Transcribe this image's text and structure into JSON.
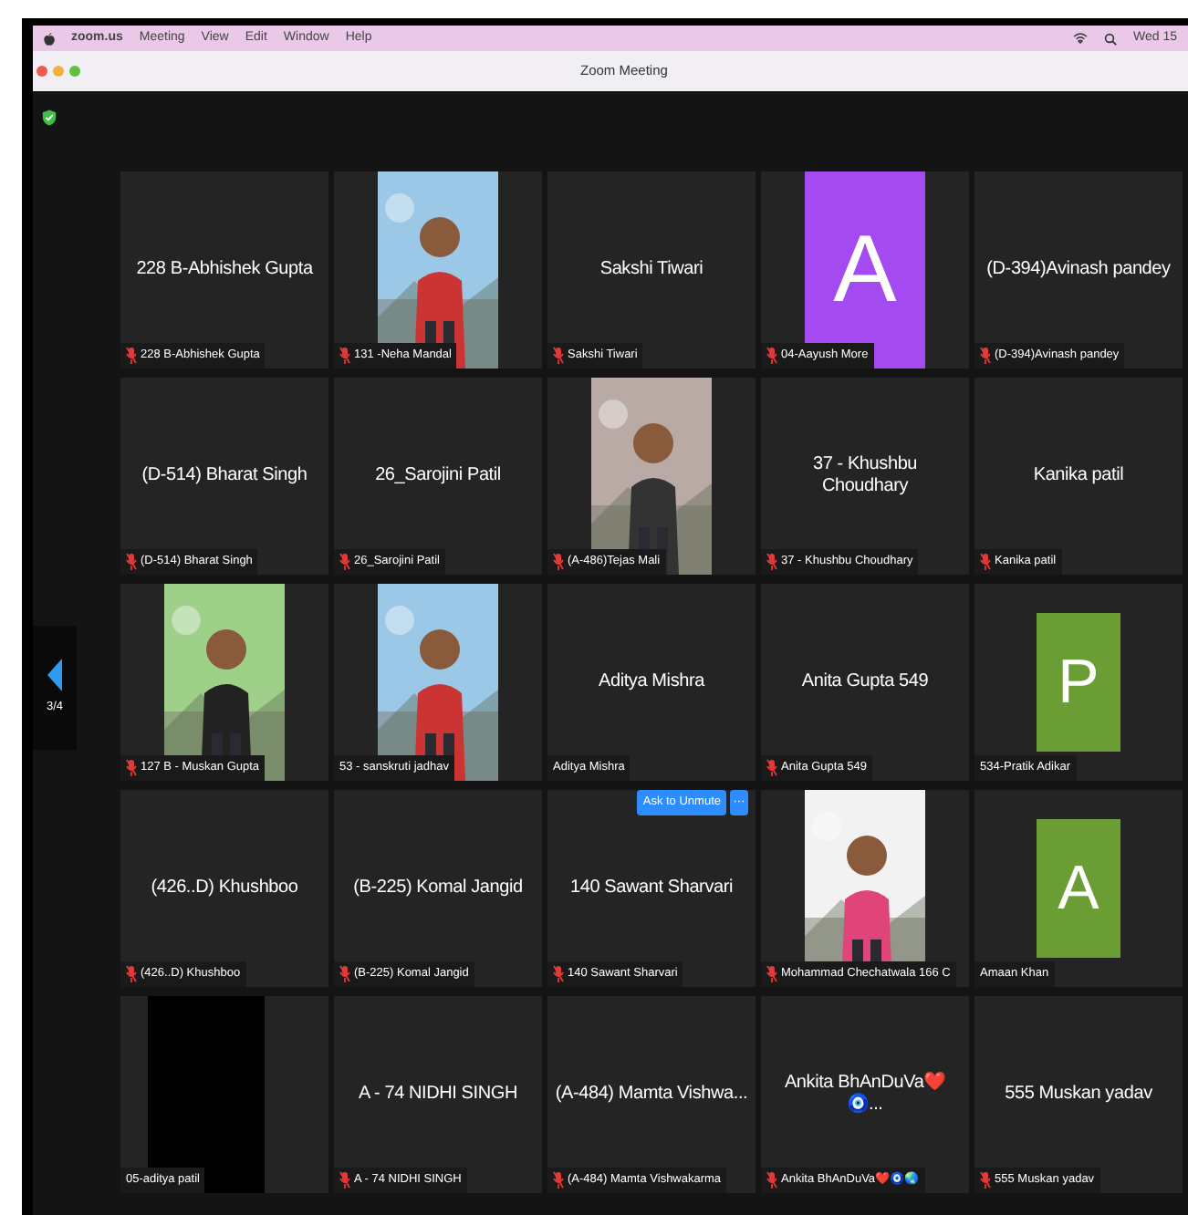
{
  "menu_bar": {
    "app": "zoom.us",
    "items": [
      "Meeting",
      "View",
      "Edit",
      "Window",
      "Help"
    ],
    "clock": "Wed 15"
  },
  "window": {
    "title": "Zoom Meeting"
  },
  "pager": {
    "label": "3/4"
  },
  "tiles": [
    {
      "kind": "name",
      "name": "228 B-Abhishek Gupta",
      "label": "228 B-Abhishek Gupta",
      "muted": true
    },
    {
      "kind": "picture",
      "label": "131 -Neha Mandal",
      "muted": true
    },
    {
      "kind": "name",
      "name": "Sakshi Tiwari",
      "label": "Sakshi Tiwari",
      "muted": true
    },
    {
      "kind": "avatar",
      "letter": "A",
      "color": "#a34bf0",
      "large": true,
      "label": "04-Aayush More",
      "muted": true
    },
    {
      "kind": "name",
      "name": "(D-394)Avinash pandey",
      "label": "(D-394)Avinash pandey",
      "muted": true
    },
    {
      "kind": "name",
      "name": "(D-514) Bharat Singh",
      "label": "(D-514) Bharat Singh",
      "muted": true
    },
    {
      "kind": "name",
      "name": "26_Sarojini Patil",
      "label": "26_Sarojini Patil",
      "muted": true
    },
    {
      "kind": "picture",
      "label": "(A-486)Tejas Mali",
      "muted": true
    },
    {
      "kind": "name",
      "name": "37 - Khushbu Choudhary",
      "label": "37 - Khushbu Choudhary",
      "muted": true
    },
    {
      "kind": "name",
      "name": "Kanika patil",
      "label": "Kanika patil",
      "muted": true
    },
    {
      "kind": "picture",
      "label": "127 B - Muskan Gupta",
      "muted": true
    },
    {
      "kind": "picture",
      "label": "53 - sanskruti jadhav",
      "muted": false
    },
    {
      "kind": "name",
      "name": "Aditya Mishra",
      "label": "Aditya Mishra",
      "muted": false
    },
    {
      "kind": "name",
      "name": "Anita Gupta 549",
      "label": "Anita Gupta 549",
      "muted": true
    },
    {
      "kind": "avatar",
      "letter": "P",
      "color": "#6a9e35",
      "large": false,
      "label": "534-Pratik Adikar",
      "muted": false
    },
    {
      "kind": "name",
      "name": "(426..D) Khushboo",
      "label": "(426..D) Khushboo",
      "muted": true
    },
    {
      "kind": "name",
      "name": "(B-225) Komal Jangid",
      "label": "(B-225) Komal Jangid",
      "muted": true
    },
    {
      "kind": "name",
      "name": "140 Sawant Sharvari",
      "label": "140 Sawant Sharvari",
      "muted": true,
      "ask_button": "Ask to Unmute",
      "more_button": "···"
    },
    {
      "kind": "picture",
      "label": "Mohammad Chechatwala 166 C",
      "muted": true
    },
    {
      "kind": "avatar",
      "letter": "A",
      "color": "#6a9e35",
      "large": false,
      "label": "Amaan Khan",
      "muted": false
    },
    {
      "kind": "blank",
      "label": "05-aditya patil",
      "muted": false
    },
    {
      "kind": "name",
      "name": "A - 74  NIDHI SINGH",
      "label": "A - 74  NIDHI SINGH",
      "muted": true
    },
    {
      "kind": "name",
      "name": "(A-484) Mamta Vishwa...",
      "label": "(A-484) Mamta Vishwakarma",
      "muted": true
    },
    {
      "kind": "name",
      "name": "Ankita BhAnDuVa❤️ 🧿...",
      "label": "Ankita BhAnDuVa❤️🧿🌏",
      "muted": true
    },
    {
      "kind": "name",
      "name": "555 Muskan yadav",
      "label": "555 Muskan yadav",
      "muted": true
    }
  ]
}
